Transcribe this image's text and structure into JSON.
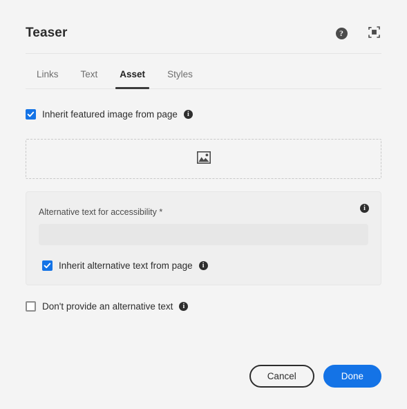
{
  "dialog": {
    "title": "Teaser",
    "header_icons": [
      {
        "name": "help-icon",
        "glyph": "?"
      },
      {
        "name": "fullscreen-icon",
        "glyph": ""
      }
    ]
  },
  "tabs": [
    {
      "label": "Links",
      "active": false
    },
    {
      "label": "Text",
      "active": false
    },
    {
      "label": "Asset",
      "active": true
    },
    {
      "label": "Styles",
      "active": false
    }
  ],
  "asset_tab": {
    "inherit_featured_image": {
      "label": "Inherit featured image from page",
      "checked": true,
      "info_glyph": "i"
    },
    "dropzone": {
      "icon": "image-placeholder-icon"
    },
    "alt_text_card": {
      "info_glyph": "i",
      "field_label": "Alternative text for accessibility *",
      "field_value": "",
      "field_placeholder": "",
      "inherit_alt_text": {
        "label": "Inherit alternative text from page",
        "checked": true,
        "info_glyph": "i"
      }
    },
    "no_alt_text": {
      "label": "Don't provide an alternative text",
      "checked": false,
      "info_glyph": "i"
    }
  },
  "footer": {
    "cancel_label": "Cancel",
    "done_label": "Done"
  },
  "colors": {
    "accent": "#1473E6",
    "page_bg": "#F4F4F4",
    "card_bg": "#EFEFEF",
    "input_bg": "#E7E7E7",
    "text": "#2C2C2C",
    "muted_text": "#6E6E6E"
  }
}
